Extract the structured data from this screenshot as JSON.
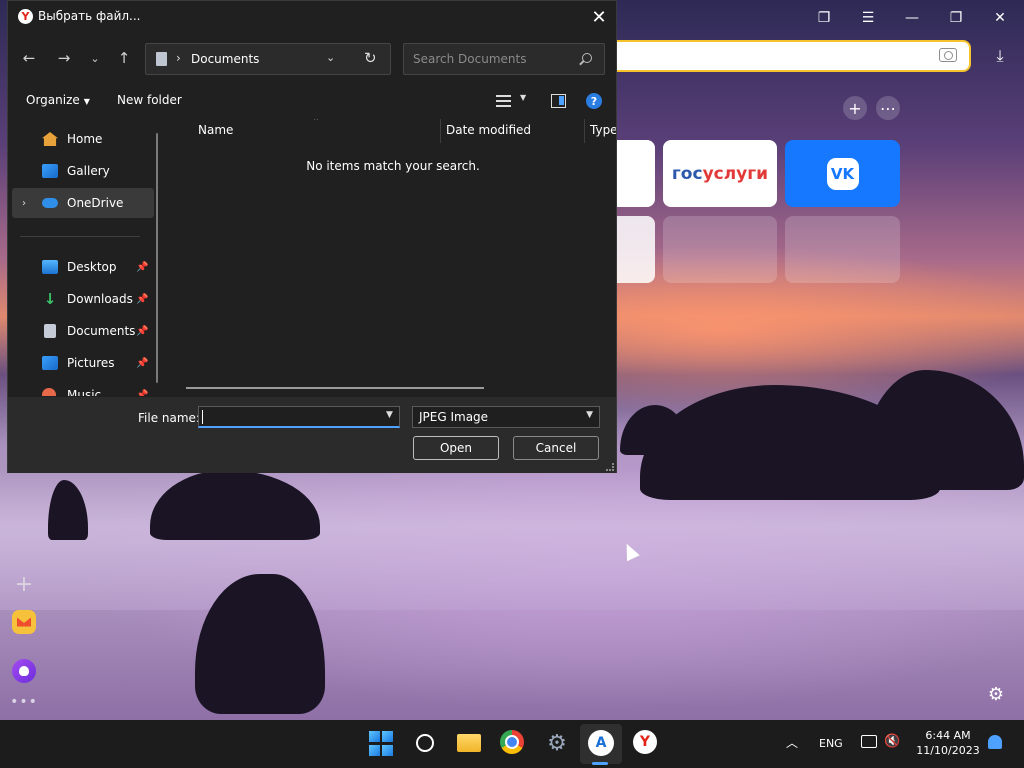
{
  "dialog": {
    "title": "Выбрать файл...",
    "path": {
      "current": "Documents"
    },
    "search": {
      "placeholder": "Search Documents"
    },
    "toolbar": {
      "organize": "Organize",
      "new_folder": "New folder"
    },
    "nav_items": [
      {
        "label": "Home",
        "icon": "home-icon"
      },
      {
        "label": "Gallery",
        "icon": "gallery-icon"
      },
      {
        "label": "OneDrive",
        "icon": "cloud-icon",
        "selected": true
      },
      {
        "label": "Desktop",
        "icon": "desktop-icon",
        "pinned": true
      },
      {
        "label": "Downloads",
        "icon": "download-icon",
        "pinned": true
      },
      {
        "label": "Documents",
        "icon": "document-icon",
        "pinned": true
      },
      {
        "label": "Pictures",
        "icon": "picture-icon",
        "pinned": true
      },
      {
        "label": "Music",
        "icon": "music-icon",
        "pinned": true
      }
    ],
    "columns": [
      "Name",
      "Date modified",
      "Type"
    ],
    "empty_message": "No items match your search.",
    "file_name_label": "File name:",
    "file_name_value": "",
    "file_type": "JPEG Image",
    "open_label": "Open",
    "cancel_label": "Cancel"
  },
  "browser": {
    "tiles": [
      {
        "label_part1": "гос",
        "label_part2": "услуги",
        "colors": [
          "#2c58ad",
          "#e23a38"
        ]
      },
      {
        "label": "VK",
        "color": "#1677ff"
      }
    ]
  },
  "taskbar": {
    "apps": [
      "windows-start",
      "search",
      "file-explorer",
      "chrome",
      "settings",
      "store",
      "yandex-browser"
    ],
    "language": "ENG",
    "time": "6:44 AM",
    "date": "11/10/2023"
  }
}
